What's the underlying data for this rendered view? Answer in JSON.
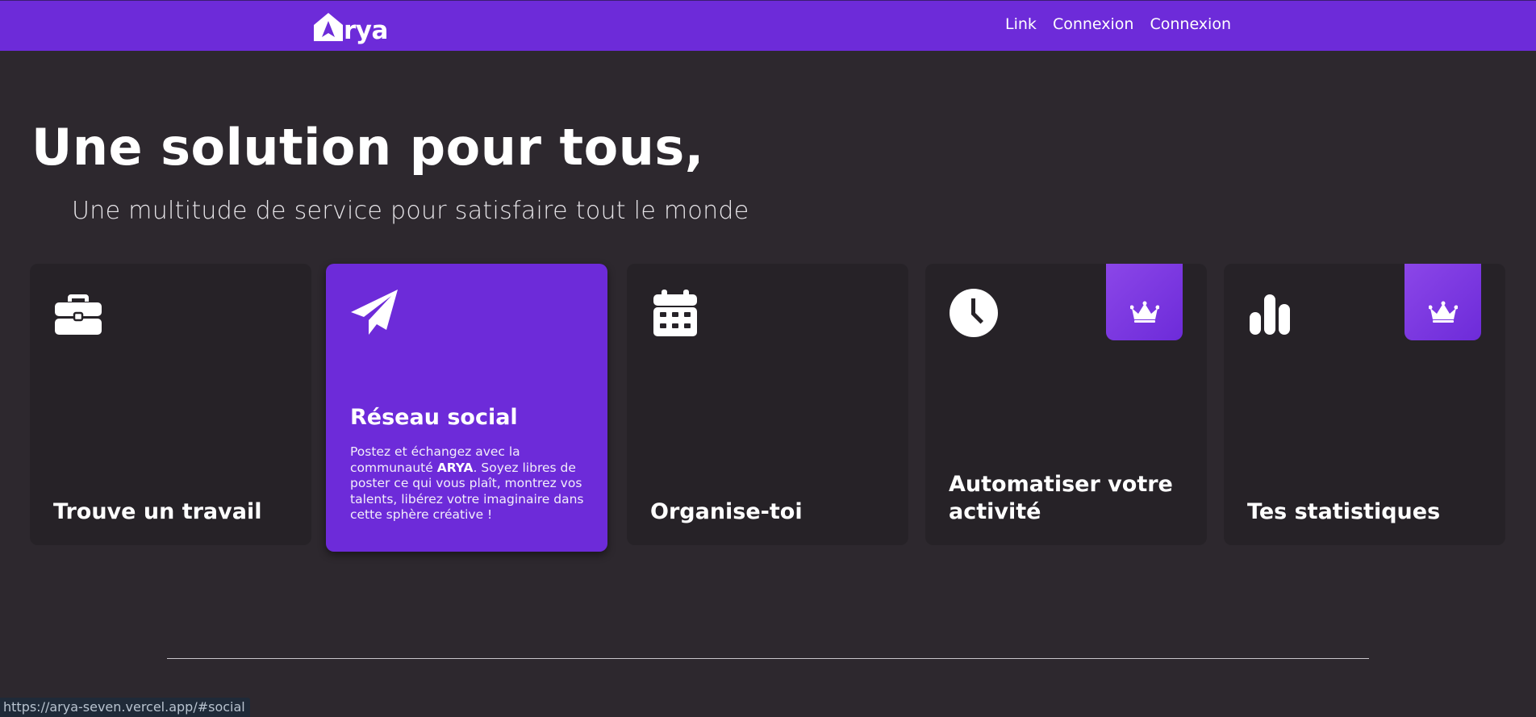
{
  "navbar": {
    "logo_text": "rya",
    "links": [
      "Link",
      "Connexion",
      "Connexion"
    ]
  },
  "hero": {
    "title": "Une solution pour tous,",
    "subtitle": "Une multitude de service pour satisfaire tout le monde"
  },
  "cards": [
    {
      "icon": "briefcase-icon",
      "title": "Trouve un travail"
    },
    {
      "icon": "paper-plane-icon",
      "title": "Réseau social",
      "desc_before": "Postez et échangez avec la communauté ",
      "desc_bold": "ARYA",
      "desc_after": ". Soyez libres de poster ce qui vous plaît, montrez vos talents, libérez votre imaginaire dans cette sphère créative !"
    },
    {
      "icon": "calendar-icon",
      "title": "Organise-toi"
    },
    {
      "icon": "clock-icon",
      "title": "Automatiser votre activité",
      "premium": true
    },
    {
      "icon": "bar-chart-icon",
      "title": "Tes statistiques",
      "premium": true
    }
  ],
  "status_bar": {
    "url": "https://arya-seven.vercel.app/#social"
  },
  "colors": {
    "accent": "#6d2bd9",
    "background": "#2d282e",
    "card": "#262227"
  }
}
